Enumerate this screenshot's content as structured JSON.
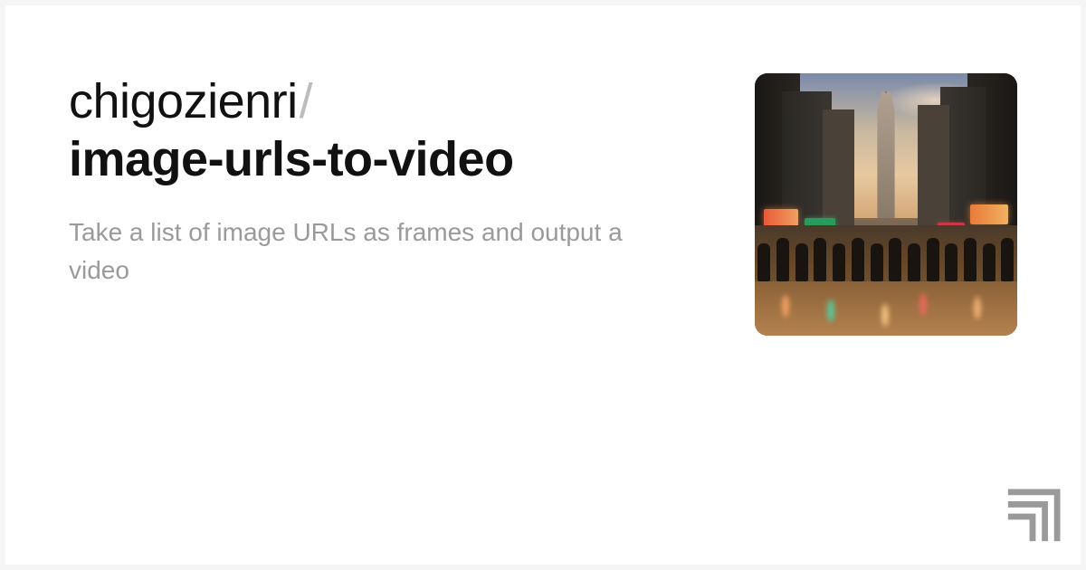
{
  "owner": "chigozienri",
  "separator": "/",
  "repo": "image-urls-to-video",
  "description": "Take a list of image URLs as frames and output a video"
}
